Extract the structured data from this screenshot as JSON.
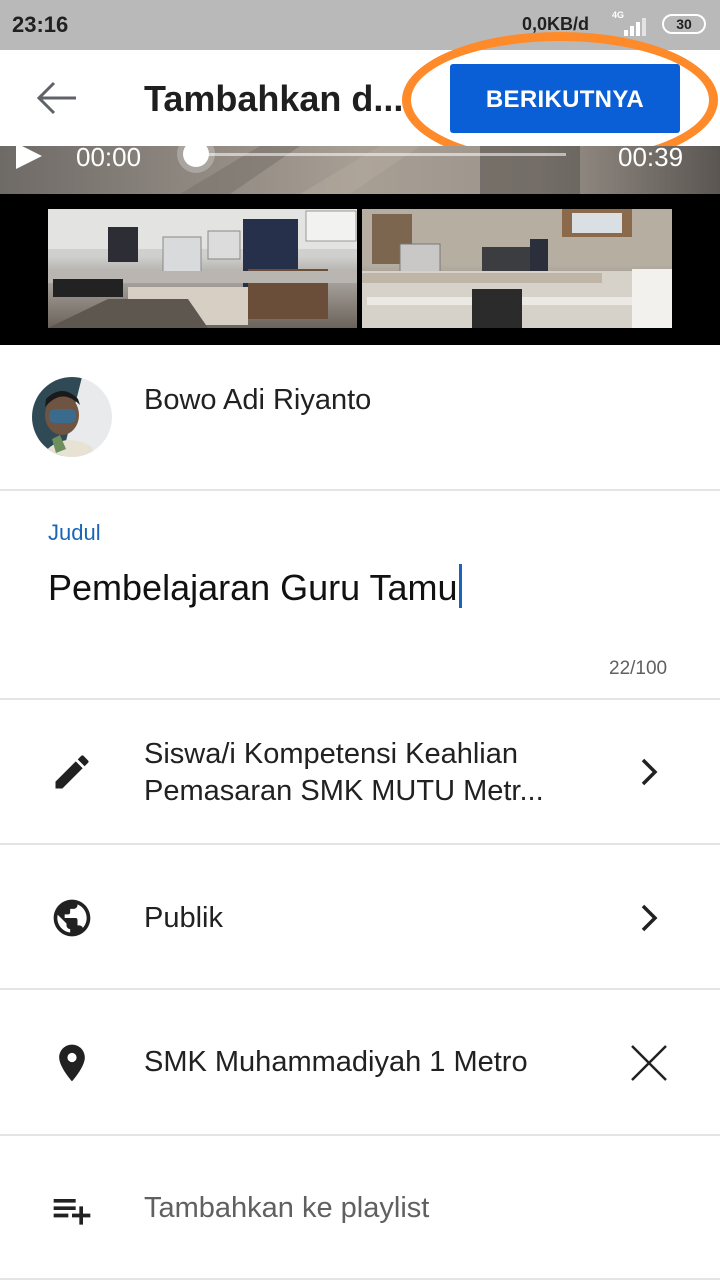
{
  "status_bar": {
    "time": "23:16",
    "network_speed": "0,0KB/d",
    "network_type": "4G",
    "battery": "30"
  },
  "header": {
    "back_icon": "arrow-left-icon",
    "title": "Tambahkan d...",
    "next_label": "BERIKUTNYA",
    "highlight_color": "#ff8a2a",
    "accent": "#0a5fd6"
  },
  "player": {
    "current_time": "00:00",
    "duration": "00:39",
    "progress": 0
  },
  "channel": {
    "name": "Bowo Adi Riyanto"
  },
  "title_field": {
    "label": "Judul",
    "value": "Pembelajaran Guru Tamu",
    "counter": "22/100"
  },
  "rows": {
    "description": {
      "icon": "pencil-icon",
      "line1": "Siswa/i Kompetensi Keahlian",
      "line2": "Pemasaran SMK MUTU Metr..."
    },
    "visibility": {
      "icon": "globe-icon",
      "label": "Publik"
    },
    "location": {
      "icon": "location-pin-icon",
      "label": "SMK Muhammadiyah 1 Metro"
    },
    "playlist": {
      "icon": "playlist-add-icon",
      "label": "Tambahkan ke playlist"
    }
  }
}
